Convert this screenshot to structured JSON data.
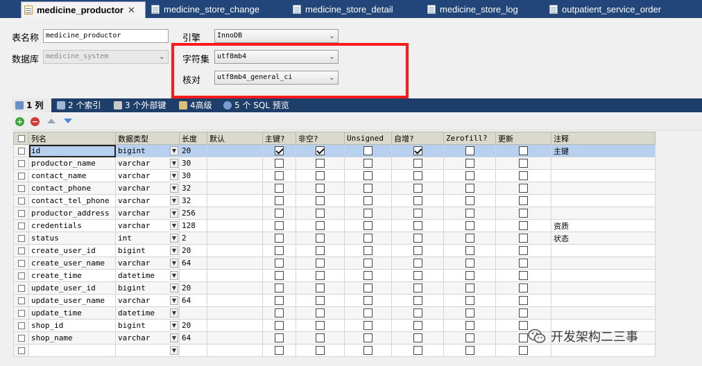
{
  "tabs": [
    {
      "label": "medicine_productor",
      "active": true,
      "close": "✕"
    },
    {
      "label": "medicine_store_change",
      "active": false
    },
    {
      "label": "medicine_store_detail",
      "active": false
    },
    {
      "label": "medicine_store_log",
      "active": false
    },
    {
      "label": "outpatient_service_order",
      "active": false
    }
  ],
  "form": {
    "table_name_label": "表名称",
    "table_name_value": "medicine_productor",
    "database_label": "数据库",
    "database_value": "medicine_system",
    "engine_label": "引擎",
    "engine_value": "InnoDB",
    "charset_label": "字符集",
    "charset_value": "utf8mb4",
    "collation_label": "核对",
    "collation_value": "utf8mb4_general_ci"
  },
  "subtabs": [
    {
      "label": "1 列",
      "active": true,
      "icon": "columns-icon"
    },
    {
      "label": "2 个索引",
      "icon": "index-icon"
    },
    {
      "label": "3 个外部键",
      "icon": "foreign-key-icon"
    },
    {
      "label": "4高级",
      "icon": "advanced-icon"
    },
    {
      "label": "5 个 SQL 预览",
      "icon": "sql-preview-icon"
    }
  ],
  "toolbar": {
    "add_icon": "plus-icon",
    "remove_icon": "minus-icon",
    "up_icon": "arrow-up-icon",
    "down_icon": "arrow-down-icon"
  },
  "grid": {
    "headers": [
      "列名",
      "数据类型",
      "长度",
      "默认",
      "主键?",
      "非空?",
      "Unsigned",
      "自增?",
      "Zerofill?",
      "更新",
      "注释"
    ],
    "rows": [
      {
        "name": "id",
        "type": "bigint",
        "length": "20",
        "default": "",
        "pk": true,
        "notnull": true,
        "unsigned": false,
        "ai": true,
        "zerofill": false,
        "update": false,
        "comment": "主键"
      },
      {
        "name": "productor_name",
        "type": "varchar",
        "length": "30",
        "default": "",
        "pk": false,
        "notnull": false,
        "unsigned": false,
        "ai": false,
        "zerofill": false,
        "update": false,
        "comment": ""
      },
      {
        "name": "contact_name",
        "type": "varchar",
        "length": "30",
        "default": "",
        "pk": false,
        "notnull": false,
        "unsigned": false,
        "ai": false,
        "zerofill": false,
        "update": false,
        "comment": ""
      },
      {
        "name": "contact_phone",
        "type": "varchar",
        "length": "32",
        "default": "",
        "pk": false,
        "notnull": false,
        "unsigned": false,
        "ai": false,
        "zerofill": false,
        "update": false,
        "comment": ""
      },
      {
        "name": "contact_tel_phone",
        "type": "varchar",
        "length": "32",
        "default": "",
        "pk": false,
        "notnull": false,
        "unsigned": false,
        "ai": false,
        "zerofill": false,
        "update": false,
        "comment": ""
      },
      {
        "name": "productor_address",
        "type": "varchar",
        "length": "256",
        "default": "",
        "pk": false,
        "notnull": false,
        "unsigned": false,
        "ai": false,
        "zerofill": false,
        "update": false,
        "comment": ""
      },
      {
        "name": "credentials",
        "type": "varchar",
        "length": "128",
        "default": "",
        "pk": false,
        "notnull": false,
        "unsigned": false,
        "ai": false,
        "zerofill": false,
        "update": false,
        "comment": "资质"
      },
      {
        "name": "status",
        "type": "int",
        "length": "2",
        "default": "",
        "pk": false,
        "notnull": false,
        "unsigned": false,
        "ai": false,
        "zerofill": false,
        "update": false,
        "comment": "状态"
      },
      {
        "name": "create_user_id",
        "type": "bigint",
        "length": "20",
        "default": "",
        "pk": false,
        "notnull": false,
        "unsigned": false,
        "ai": false,
        "zerofill": false,
        "update": false,
        "comment": ""
      },
      {
        "name": "create_user_name",
        "type": "varchar",
        "length": "64",
        "default": "",
        "pk": false,
        "notnull": false,
        "unsigned": false,
        "ai": false,
        "zerofill": false,
        "update": false,
        "comment": ""
      },
      {
        "name": "create_time",
        "type": "datetime",
        "length": "",
        "default": "",
        "pk": false,
        "notnull": false,
        "unsigned": false,
        "ai": false,
        "zerofill": false,
        "update": false,
        "comment": ""
      },
      {
        "name": "update_user_id",
        "type": "bigint",
        "length": "20",
        "default": "",
        "pk": false,
        "notnull": false,
        "unsigned": false,
        "ai": false,
        "zerofill": false,
        "update": false,
        "comment": ""
      },
      {
        "name": "update_user_name",
        "type": "varchar",
        "length": "64",
        "default": "",
        "pk": false,
        "notnull": false,
        "unsigned": false,
        "ai": false,
        "zerofill": false,
        "update": false,
        "comment": ""
      },
      {
        "name": "update_time",
        "type": "datetime",
        "length": "",
        "default": "",
        "pk": false,
        "notnull": false,
        "unsigned": false,
        "ai": false,
        "zerofill": false,
        "update": false,
        "comment": ""
      },
      {
        "name": "shop_id",
        "type": "bigint",
        "length": "20",
        "default": "",
        "pk": false,
        "notnull": false,
        "unsigned": false,
        "ai": false,
        "zerofill": false,
        "update": false,
        "comment": ""
      },
      {
        "name": "shop_name",
        "type": "varchar",
        "length": "64",
        "default": "",
        "pk": false,
        "notnull": false,
        "unsigned": false,
        "ai": false,
        "zerofill": false,
        "update": false,
        "comment": ""
      },
      {
        "name": "",
        "type": "",
        "length": "",
        "default": "",
        "pk": false,
        "notnull": false,
        "unsigned": false,
        "ai": false,
        "zerofill": false,
        "update": false,
        "comment": ""
      }
    ]
  },
  "watermark": {
    "text": "开发架构二三事",
    "icon": "wechat-icon"
  },
  "colors": {
    "tabbar": "#22467a",
    "highlight": "#ff1a1a",
    "selected_row": "#b7d0ef",
    "header_bg": "#d9d9cd"
  }
}
